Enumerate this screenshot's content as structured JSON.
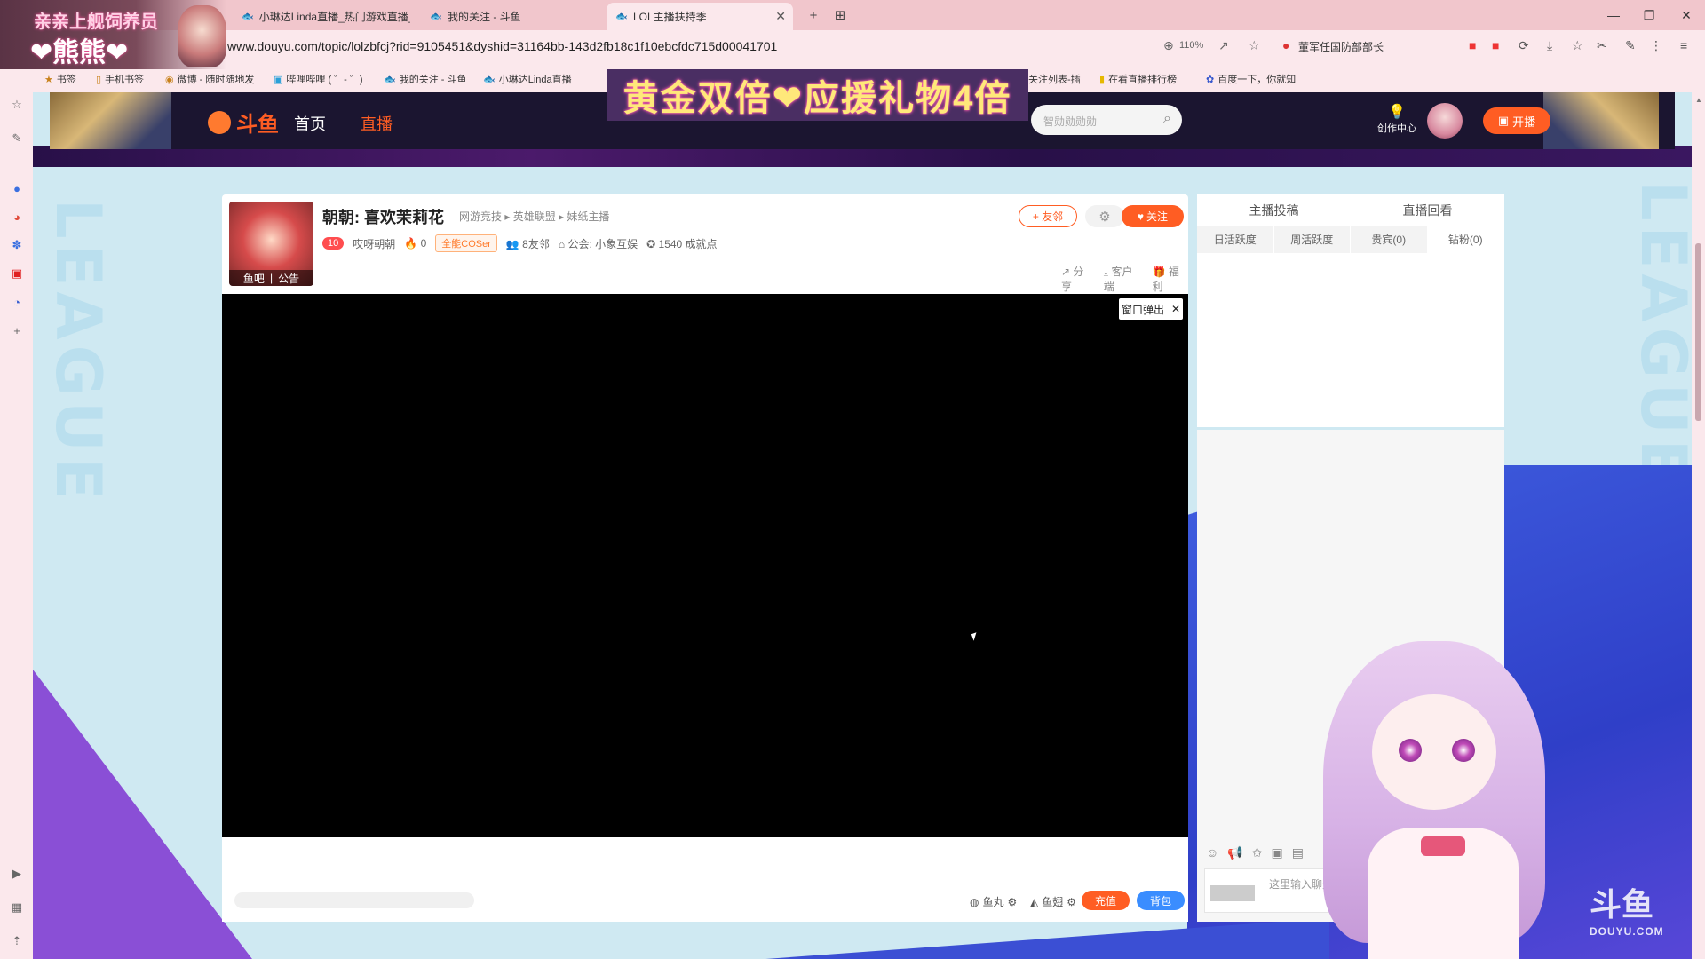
{
  "browser": {
    "tabs": [
      {
        "title": "小琳达Linda直播_热门游戏直播_",
        "active": false
      },
      {
        "title": "我的关注 - 斗鱼",
        "active": false
      },
      {
        "title": "LOL主播扶持季",
        "active": true
      }
    ],
    "url": "www.douyu.com/topic/lolzbfcj?rid=9105451&dyshid=31164bb-143d2fb18c1f10ebcfdc715d00041701",
    "zoom": "110%",
    "news_ext": "董军任国防部部长",
    "bookmarks": [
      "书签",
      "手机书签",
      "微博 - 随时随地发",
      "哔哩哔哩 ( ゜- ゜)",
      "我的关注 - 斗鱼",
      "小琳达Linda直播",
      "关注列表-插",
      "在看直播排行榜",
      "百度一下，你就知"
    ]
  },
  "header": {
    "logo": "斗鱼",
    "nav_home": "首页",
    "nav_live": "直播",
    "search_placeholder": "智勋勋勋勋",
    "create_center": "创作中心",
    "start_live": "开播"
  },
  "overlay": {
    "banner_text": "黄金双倍❤应援礼物4倍",
    "top_left_line1": "亲亲上舰饲养员",
    "top_left_line2": "❤熊熊❤",
    "watermark": "斗鱼",
    "watermark_sub": "DOUYU.COM"
  },
  "room": {
    "anchor_name": "朝朝",
    "title": "朝朝: 喜欢茉莉花",
    "category": "网游竞技 ▸ 英雄联盟 ▸ 妹纸主播",
    "level": "10",
    "nickname": "哎呀朝朝",
    "heat": "0",
    "cos_badge": "全能COSer",
    "friends": "8友邻",
    "guild": "公会: 小象互娱",
    "growth": "1540 成就点",
    "avatar_tag_left": "鱼吧",
    "avatar_tag_right": "公告",
    "friend_btn": "友邻",
    "follow_btn": "关注",
    "share": "分享",
    "client": "客户端",
    "welfare": "福利"
  },
  "video": {
    "popout_label": "窗口弹出"
  },
  "bottom": {
    "fish_ball": "鱼丸",
    "fish_wing": "鱼翅",
    "charge": "充值",
    "bag": "背包"
  },
  "right_panel": {
    "tabs": [
      "主播投稿",
      "直播回看"
    ],
    "subtabs": [
      "日活跃度",
      "周活跃度",
      "贵宾(0)",
      "钻粉(0)"
    ],
    "chat_placeholder": "这里输入聊天"
  },
  "colors": {
    "accent": "#ff5d23",
    "blue": "#3a8dff"
  }
}
